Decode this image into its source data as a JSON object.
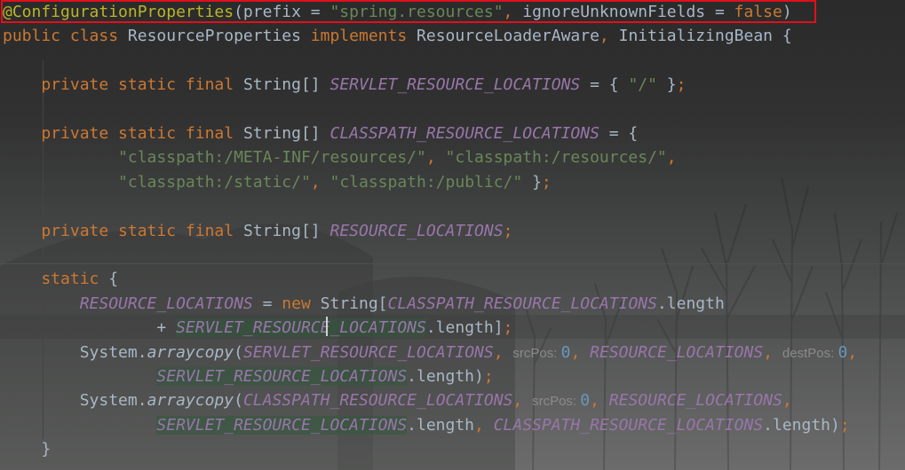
{
  "editor": {
    "lines": [
      [
        {
          "t": "@ConfigurationProperties",
          "c": "an"
        },
        {
          "t": "(prefix = ",
          "c": "df"
        },
        {
          "t": "\"spring.resources\"",
          "c": "st"
        },
        {
          "t": ", ",
          "c": "kw"
        },
        {
          "t": "ignoreUnknownFields = ",
          "c": "df"
        },
        {
          "t": "false",
          "c": "kw"
        },
        {
          "t": ")",
          "c": "df"
        }
      ],
      [
        {
          "t": "public class ",
          "c": "kw"
        },
        {
          "t": "ResourceProperties ",
          "c": "df"
        },
        {
          "t": "implements ",
          "c": "kw"
        },
        {
          "t": "ResourceLoaderAware",
          "c": "df"
        },
        {
          "t": ", ",
          "c": "kw"
        },
        {
          "t": "InitializingBean {",
          "c": "df"
        }
      ],
      [],
      [
        {
          "t": "    private static final ",
          "c": "kw"
        },
        {
          "t": "String[] ",
          "c": "df"
        },
        {
          "t": "SERVLET_RESOURCE_LOCATIONS",
          "c": "fi"
        },
        {
          "t": " = { ",
          "c": "df"
        },
        {
          "t": "\"/\"",
          "c": "st"
        },
        {
          "t": " }",
          "c": "df"
        },
        {
          "t": ";",
          "c": "kw"
        }
      ],
      [],
      [
        {
          "t": "    private static final ",
          "c": "kw"
        },
        {
          "t": "String[] ",
          "c": "df"
        },
        {
          "t": "CLASSPATH_RESOURCE_LOCATIONS",
          "c": "fi"
        },
        {
          "t": " = {",
          "c": "df"
        }
      ],
      [
        {
          "t": "            ",
          "c": "df"
        },
        {
          "t": "\"classpath:/META-INF/resources/\"",
          "c": "st"
        },
        {
          "t": ", ",
          "c": "kw"
        },
        {
          "t": "\"classpath:/resources/\"",
          "c": "st"
        },
        {
          "t": ",",
          "c": "kw"
        }
      ],
      [
        {
          "t": "            ",
          "c": "df"
        },
        {
          "t": "\"classpath:/static/\"",
          "c": "st"
        },
        {
          "t": ", ",
          "c": "kw"
        },
        {
          "t": "\"classpath:/public/\"",
          "c": "st"
        },
        {
          "t": " }",
          "c": "df"
        },
        {
          "t": ";",
          "c": "kw"
        }
      ],
      [],
      [
        {
          "t": "    private static final ",
          "c": "kw"
        },
        {
          "t": "String[] ",
          "c": "df"
        },
        {
          "t": "RESOURCE_LOCATIONS",
          "c": "fi"
        },
        {
          "t": ";",
          "c": "kw"
        }
      ],
      [],
      [
        {
          "t": "    static ",
          "c": "kw"
        },
        {
          "t": "{",
          "c": "df"
        }
      ],
      [
        {
          "t": "        ",
          "c": "df"
        },
        {
          "t": "RESOURCE_LOCATIONS",
          "c": "fi"
        },
        {
          "t": " = ",
          "c": "df"
        },
        {
          "t": "new ",
          "c": "kw"
        },
        {
          "t": "String[",
          "c": "df"
        },
        {
          "t": "CLASSPATH_RESOURCE_LOCATIONS",
          "c": "fi"
        },
        {
          "t": ".length",
          "c": "df"
        }
      ],
      [
        {
          "t": "                + ",
          "c": "df"
        },
        {
          "t": "SERVLET_RESOURCE_LOCATIONS",
          "c": "fi",
          "hl": true
        },
        {
          "t": ".length]",
          "c": "df"
        },
        {
          "t": ";",
          "c": "kw"
        }
      ],
      [
        {
          "t": "        System.",
          "c": "df"
        },
        {
          "t": "arraycopy",
          "c": "me"
        },
        {
          "t": "(",
          "c": "df"
        },
        {
          "t": "SERVLET_RESOURCE_LOCATIONS",
          "c": "fi"
        },
        {
          "t": ", ",
          "c": "kw"
        },
        {
          "t": "srcPos: ",
          "c": "hint"
        },
        {
          "t": "0",
          "c": "nu"
        },
        {
          "t": ", ",
          "c": "kw"
        },
        {
          "t": "RESOURCE_LOCATIONS",
          "c": "fi"
        },
        {
          "t": ", ",
          "c": "kw"
        },
        {
          "t": "destPos: ",
          "c": "hint"
        },
        {
          "t": "0",
          "c": "nu"
        },
        {
          "t": ",",
          "c": "kw"
        }
      ],
      [
        {
          "t": "                ",
          "c": "df"
        },
        {
          "t": "SERVLET_RESOURCE_LOCATIONS",
          "c": "fi",
          "hl": true
        },
        {
          "t": ".length)",
          "c": "df"
        },
        {
          "t": ";",
          "c": "kw"
        }
      ],
      [
        {
          "t": "        System.",
          "c": "df"
        },
        {
          "t": "arraycopy",
          "c": "me"
        },
        {
          "t": "(",
          "c": "df"
        },
        {
          "t": "CLASSPATH_RESOURCE_LOCATIONS",
          "c": "fi"
        },
        {
          "t": ", ",
          "c": "kw"
        },
        {
          "t": "srcPos: ",
          "c": "hint"
        },
        {
          "t": "0",
          "c": "nu"
        },
        {
          "t": ", ",
          "c": "kw"
        },
        {
          "t": "RESOURCE_LOCATIONS",
          "c": "fi"
        },
        {
          "t": ",",
          "c": "kw"
        }
      ],
      [
        {
          "t": "                ",
          "c": "df"
        },
        {
          "t": "SERVLET_RESOURCE_LOCATIONS",
          "c": "fi",
          "hl": true
        },
        {
          "t": ".length",
          "c": "df"
        },
        {
          "t": ", ",
          "c": "kw"
        },
        {
          "t": "CLASSPATH_RESOURCE_LOCATIONS",
          "c": "fi"
        },
        {
          "t": ".length)",
          "c": "df"
        },
        {
          "t": ";",
          "c": "kw"
        }
      ],
      [
        {
          "t": "    }",
          "c": "df"
        }
      ]
    ]
  },
  "colors": {
    "keyword": "#cc7832",
    "annotation": "#bbb529",
    "string": "#6a8759",
    "field": "#9876aa",
    "number": "#6897bb",
    "default": "#a9b7c6",
    "highlight_box": "#e0101b"
  }
}
